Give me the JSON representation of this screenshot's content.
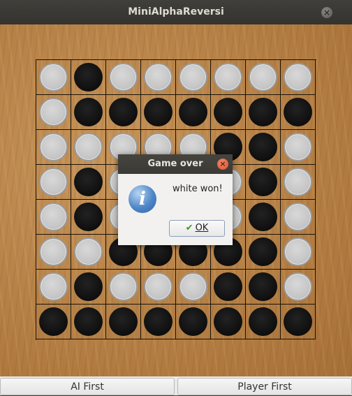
{
  "window": {
    "title": "MiniAlphaReversi",
    "close_glyph": "×"
  },
  "board": {
    "rows": [
      "WBWWWWWW",
      "WBBBBBBB",
      "WWWWWBBW",
      "WBWWWWBW",
      "WBWWWWBW",
      "WWBBBBBW",
      "WBWWWBBW",
      "BBBBBBBB"
    ]
  },
  "dialog": {
    "title": "Game over",
    "message": "white won!",
    "ok_label": "OK",
    "close_glyph": "×",
    "icon": "info-icon",
    "icon_glyph": "i",
    "check_glyph": "✔"
  },
  "controls": {
    "ai_first": "AI First",
    "player_first": "Player First"
  },
  "colors": {
    "white_piece": "#c6c6c6",
    "black_piece": "#111111",
    "board_wood": "#b07a40"
  }
}
